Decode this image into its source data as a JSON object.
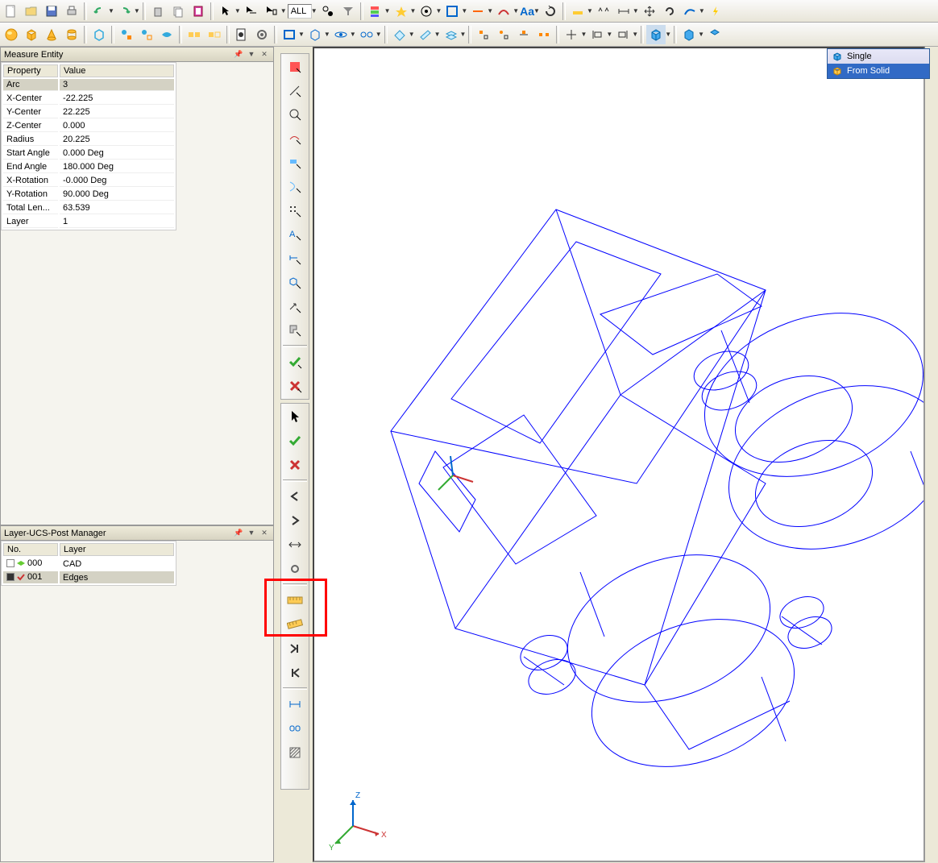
{
  "toolbar": {
    "all_label": "ALL",
    "aa_label": "Aa"
  },
  "measure_panel": {
    "title": "Measure Entity",
    "col_property": "Property",
    "col_value": "Value",
    "rows": [
      {
        "prop": "Arc",
        "val": "3"
      },
      {
        "prop": "X-Center",
        "val": "-22.225"
      },
      {
        "prop": "Y-Center",
        "val": "22.225"
      },
      {
        "prop": "Z-Center",
        "val": "0.000"
      },
      {
        "prop": "Radius",
        "val": "20.225"
      },
      {
        "prop": "Start Angle",
        "val": "0.000 Deg"
      },
      {
        "prop": "End Angle",
        "val": "180.000 Deg"
      },
      {
        "prop": "X-Rotation",
        "val": "-0.000 Deg"
      },
      {
        "prop": "Y-Rotation",
        "val": "90.000 Deg"
      },
      {
        "prop": "Total Len...",
        "val": "63.539"
      },
      {
        "prop": "Layer",
        "val": "1"
      }
    ]
  },
  "layer_panel": {
    "title": "Layer-UCS-Post Manager",
    "col_no": "No.",
    "col_layer": "Layer",
    "rows": [
      {
        "no": "000",
        "name": "CAD"
      },
      {
        "no": "001",
        "name": "Edges"
      }
    ]
  },
  "context_menu": {
    "single": "Single",
    "from_solid": "From Solid"
  },
  "axes": {
    "x": "X",
    "y": "Y",
    "z": "Z"
  }
}
